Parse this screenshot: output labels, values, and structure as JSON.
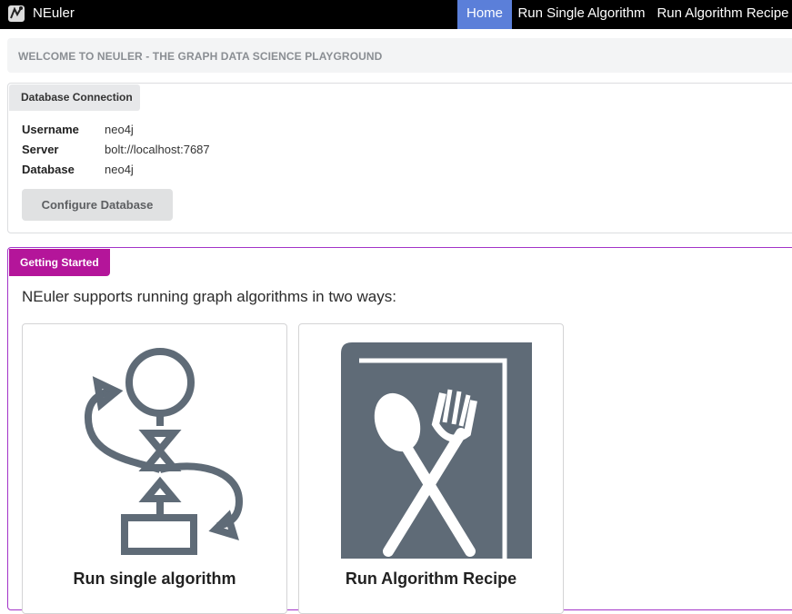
{
  "app": {
    "name": "NEuler",
    "logo_icon": "neuler-logo-icon"
  },
  "nav": {
    "items": [
      {
        "label": "Home",
        "active": true
      },
      {
        "label": "Run Single Algorithm",
        "active": false
      },
      {
        "label": "Run Algorithm Recipe",
        "active": false
      }
    ],
    "active_color": "#5b7fd9"
  },
  "welcome": {
    "text": "WELCOME TO NEULER - THE GRAPH DATA SCIENCE PLAYGROUND"
  },
  "database_connection": {
    "title": "Database Connection",
    "rows": [
      {
        "label": "Username",
        "value": "neo4j"
      },
      {
        "label": "Server",
        "value": "bolt://localhost:7687"
      },
      {
        "label": "Database",
        "value": "neo4j"
      }
    ],
    "configure_button": "Configure Database"
  },
  "getting_started": {
    "title": "Getting Started",
    "accent_color": "#b4159a",
    "intro": "NEuler supports running graph algorithms in two ways:",
    "options": [
      {
        "title": "Run single algorithm",
        "icon": "algorithm-flow-icon"
      },
      {
        "title": "Run Algorithm Recipe",
        "icon": "recipe-book-icon"
      }
    ],
    "icon_color": "#5f6b77"
  }
}
